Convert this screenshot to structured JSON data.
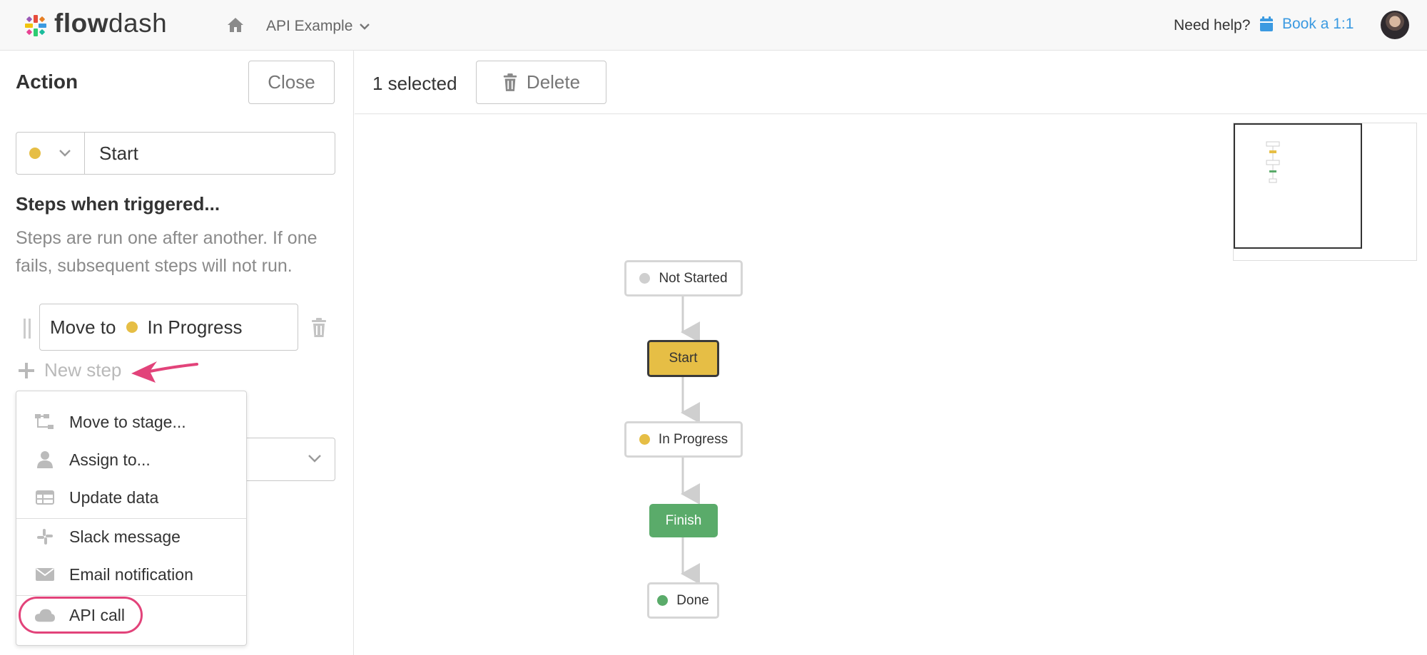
{
  "brand": {
    "name_part1": "flow",
    "name_part2": "dash"
  },
  "header": {
    "project": "API Example",
    "help_text": "Need help?",
    "book_label": "Book a 1:1"
  },
  "panel": {
    "title": "Action",
    "close_label": "Close",
    "stage": {
      "name": "Start",
      "dot_color": "#e6be45"
    },
    "steps_title": "Steps when triggered...",
    "steps_desc": "Steps are run one after another. If one fails, subsequent steps will not run.",
    "step": {
      "prefix": "Move to",
      "target": "In Progress",
      "dot_color": "#e6be45"
    },
    "new_step_label": "New step"
  },
  "menu": {
    "items": [
      {
        "label": "Move to stage...",
        "icon": "flow-tree-icon"
      },
      {
        "label": "Assign to...",
        "icon": "user-icon"
      },
      {
        "label": "Update data",
        "icon": "table-icon"
      },
      {
        "label": "Slack message",
        "icon": "slack-icon"
      },
      {
        "label": "Email notification",
        "icon": "envelope-icon"
      },
      {
        "label": "API call",
        "icon": "cloud-icon",
        "highlighted": true
      }
    ]
  },
  "toolbar": {
    "selected_text": "1 selected",
    "delete_label": "Delete"
  },
  "flow": {
    "nodes": [
      {
        "label": "Not Started",
        "style": "white",
        "dot_color": "#cfcfcf"
      },
      {
        "label": "Start",
        "style": "start"
      },
      {
        "label": "In Progress",
        "style": "white",
        "dot_color": "#e6be45"
      },
      {
        "label": "Finish",
        "style": "finish"
      },
      {
        "label": "Done",
        "style": "white",
        "dot_color": "#5aab6a"
      }
    ]
  },
  "colors": {
    "accent": "#3b9ae1",
    "highlight": "#e2437a",
    "start": "#e6be45",
    "finish": "#5aab6a"
  }
}
